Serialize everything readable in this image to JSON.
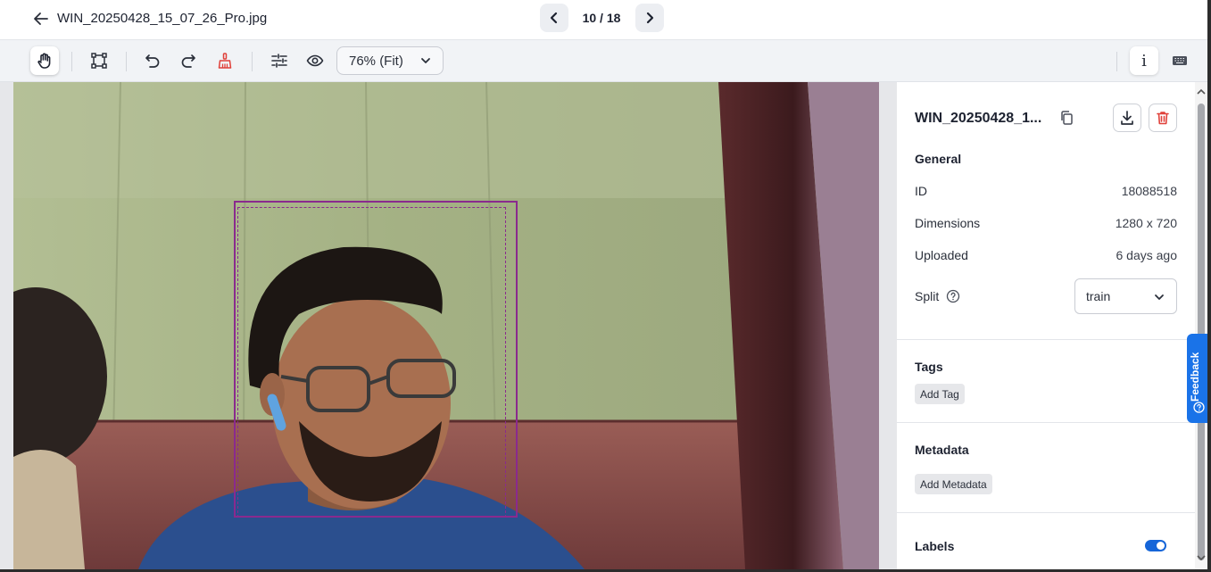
{
  "header": {
    "filename": "WIN_20250428_15_07_26_Pro.jpg",
    "counter": "10 / 18"
  },
  "toolbar": {
    "tools": [
      "pan-hand-icon",
      "bounding-box-icon",
      "undo-icon",
      "redo-icon",
      "eraser-icon",
      "adjust-sliders-icon",
      "eye-icon"
    ],
    "zoom_label": "76% (Fit)",
    "info_label": "i"
  },
  "annotation": {
    "box_color": "#8a2a8e"
  },
  "sidebar": {
    "title": "WIN_20250428_1...",
    "general": {
      "heading": "General",
      "id_label": "ID",
      "id_value": "18088518",
      "dimensions_label": "Dimensions",
      "dimensions_value": "1280 x 720",
      "uploaded_label": "Uploaded",
      "uploaded_value": "6 days ago",
      "split_label": "Split",
      "split_value": "train"
    },
    "tags": {
      "heading": "Tags",
      "add_label": "Add Tag"
    },
    "metadata": {
      "heading": "Metadata",
      "add_label": "Add Metadata"
    },
    "labels": {
      "heading": "Labels",
      "toggle_on": true
    }
  },
  "feedback": {
    "label": "Feedback"
  },
  "colors": {
    "accent": "#1565d8",
    "delete": "#e0413a",
    "eraser": "#e0413a"
  }
}
